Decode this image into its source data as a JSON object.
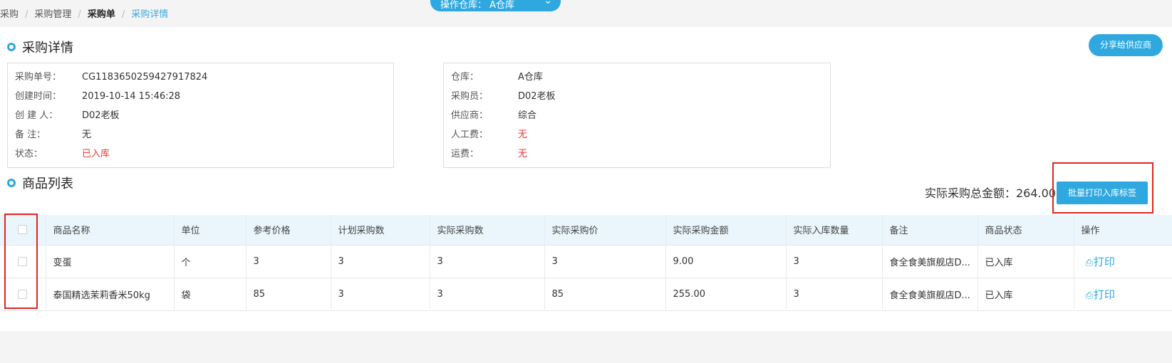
{
  "breadcrumb": [
    {
      "label": "采购"
    },
    {
      "label": "采购管理"
    },
    {
      "label": "采购单"
    },
    {
      "label": "采购详情"
    }
  ],
  "warehouse_selector": {
    "label": "操作仓库：",
    "value": "A仓库"
  },
  "details": {
    "title": "采购详情",
    "share_label": "分享给供应商",
    "left": [
      {
        "key": "采购单号：",
        "value": "CG1183650259427917824"
      },
      {
        "key": "创建时间：",
        "value": "2019-10-14 15:46:28"
      },
      {
        "key": "创 建 人：",
        "value": "D02老板"
      },
      {
        "key": "备 注：",
        "value": "无"
      },
      {
        "key": "状态：",
        "value": "已入库"
      }
    ],
    "right": [
      {
        "key": "仓库：",
        "value": "A仓库"
      },
      {
        "key": "采购员：",
        "value": "D02老板"
      },
      {
        "key": "供应商：",
        "value": "综合"
      },
      {
        "key": "人工费：",
        "value": "无"
      },
      {
        "key": "运费：",
        "value": "无"
      }
    ]
  },
  "goods": {
    "title": "商品列表",
    "total_label": "实际采购总金额：264.00",
    "batch_print_label": "批量打印入库标签",
    "columns": [
      "商品名称",
      "单位",
      "参考价格",
      "计划采购数",
      "实际采购数",
      "实际采购价",
      "实际采购金额",
      "实际入库数量",
      "备注",
      "商品状态",
      "操作"
    ],
    "rows": [
      {
        "name": "变蛋",
        "unit": "个",
        "ref_price": "3",
        "plan_qty": "3",
        "actual_qty": "3",
        "actual_price": "3",
        "actual_amount": "9.00",
        "in_qty": "3",
        "remark": "食全食美旗舰店D...",
        "status": "已入库",
        "action": "打印"
      },
      {
        "name": "泰国精选茉莉香米50kg",
        "unit": "袋",
        "ref_price": "85",
        "plan_qty": "3",
        "actual_qty": "3",
        "actual_price": "85",
        "actual_amount": "255.00",
        "in_qty": "3",
        "remark": "食全食美旗舰店D...",
        "status": "已入库",
        "action": "打印"
      }
    ]
  },
  "colors": {
    "accent": "#2fa8e0",
    "status_red": "#e53935",
    "highlight": "#e02424"
  }
}
